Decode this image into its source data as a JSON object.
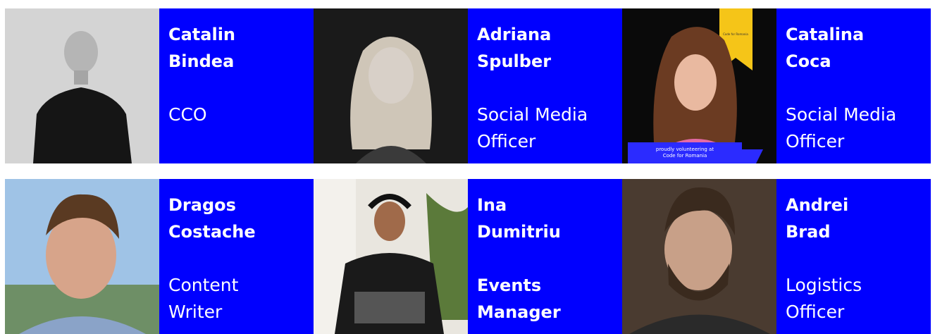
{
  "members": [
    {
      "first": "Catalin",
      "last": "Bindea",
      "role1": "CCO",
      "role2": "",
      "role_bold": false
    },
    {
      "first": "Adriana",
      "last": "Spulber",
      "role1": "Social Media",
      "role2": "Officer",
      "role_bold": false
    },
    {
      "first": "Catalina",
      "last": "Coca",
      "role1": "Social Media",
      "role2": "Officer",
      "role_bold": false,
      "badge_line1": "proudly volunteering at",
      "badge_line2": "Code for Romania",
      "ribbon_text": "Code for Romania"
    },
    {
      "first": "Dragos",
      "last": "Costache",
      "role1": "Content",
      "role2": "Writer",
      "role_bold": false
    },
    {
      "first": "Ina",
      "last": "Dumitriu",
      "role1": "Events",
      "role2": "Manager",
      "role_bold": true
    },
    {
      "first": "Andrei",
      "last": "Brad",
      "role1": "Logistics",
      "role2": "Officer",
      "role_bold": false
    }
  ],
  "colors": {
    "card_bg": "#0000ff",
    "text": "#ffffff",
    "ribbon": "#f5c518"
  }
}
